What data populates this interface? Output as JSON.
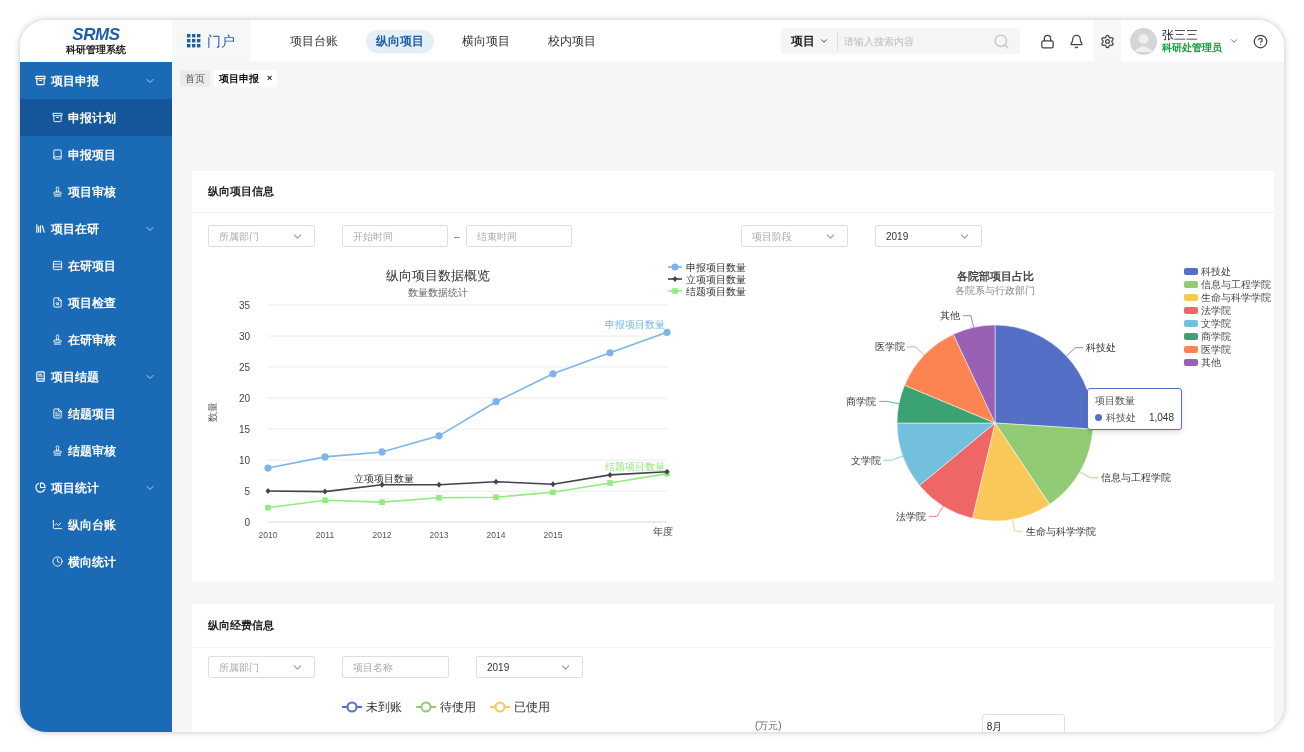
{
  "logo": {
    "mark": "SRMS",
    "subtitle": "科研管理系统"
  },
  "portal": {
    "label": "门户"
  },
  "nav_tabs": [
    {
      "label": "项目台账",
      "selected": false
    },
    {
      "label": "纵向项目",
      "selected": true
    },
    {
      "label": "横向项目",
      "selected": false
    },
    {
      "label": "校内项目",
      "selected": false
    }
  ],
  "search": {
    "scope": "项目",
    "placeholder": "请输入搜索内容"
  },
  "user": {
    "name": "张三三",
    "role": "科研处管理员"
  },
  "sidebar": {
    "groups": [
      {
        "label": "项目申报",
        "expanded": true,
        "children": [
          {
            "label": "申报计划",
            "selected": true
          },
          {
            "label": "申报项目",
            "selected": false
          },
          {
            "label": "项目审核",
            "selected": false
          }
        ]
      },
      {
        "label": "项目在研",
        "expanded": true,
        "children": [
          {
            "label": "在研项目",
            "selected": false
          },
          {
            "label": "项目检查",
            "selected": false
          },
          {
            "label": "在研审核",
            "selected": false
          }
        ]
      },
      {
        "label": "项目结题",
        "expanded": true,
        "children": [
          {
            "label": "结题项目",
            "selected": false
          },
          {
            "label": "结题审核",
            "selected": false
          }
        ]
      },
      {
        "label": "项目统计",
        "expanded": true,
        "children": [
          {
            "label": "纵向台账",
            "selected": false
          },
          {
            "label": "横向统计",
            "selected": false
          }
        ]
      }
    ]
  },
  "page_tabs": [
    {
      "label": "首页",
      "selected": false
    },
    {
      "label": "项目申报",
      "selected": true,
      "close": "×"
    }
  ],
  "project_card": {
    "title": "纵向项目信息",
    "left_filters": [
      {
        "kind": "select",
        "placeholder": "所属部门"
      },
      {
        "kind": "date_range",
        "start_placeholder": "开始时间",
        "separator": "–",
        "end_placeholder": "结束时间"
      }
    ],
    "right_filters": [
      {
        "kind": "select",
        "placeholder": "项目阶段"
      },
      {
        "kind": "select",
        "value": "2019"
      }
    ],
    "line_chart": {
      "subtitle": "数量数据统计",
      "series_labels": [
        "申报项目数量",
        "立项项目数量",
        "结题项目数量"
      ],
      "chart_data": {
        "type": "line",
        "title": "纵向项目数据概览",
        "xlabel": "年度",
        "ylabel": "数量",
        "x": [
          2010,
          2011,
          2012,
          2013,
          2014,
          2015,
          2016,
          2017
        ],
        "xlim": [
          2010,
          2017
        ],
        "grid": true,
        "legend": "upper right",
        "xticks": [
          2010,
          2011,
          2012,
          2013,
          2014,
          2015
        ],
        "ylim": [
          0,
          35
        ],
        "yticks": [
          0,
          5,
          10,
          15,
          20,
          25,
          30,
          35
        ],
        "series": [
          {
            "name": "申报项目数量",
            "color": "#7cb5ec",
            "marker": "circle",
            "values": [
              8.7,
              10.5,
              11.3,
              13.9,
              19.4,
              23.9,
              27.3,
              30.6
            ]
          },
          {
            "name": "立项项目数量",
            "color": "#434348",
            "marker": "diamond",
            "values": [
              5.0,
              4.9,
              6.0,
              6.0,
              6.5,
              6.1,
              7.6,
              8.1
            ]
          },
          {
            "name": "结题项目数量",
            "color": "#90ed7d",
            "marker": "square",
            "values": [
              2.3,
              3.5,
              3.2,
              3.9,
              4.0,
              4.8,
              6.3,
              7.8
            ]
          }
        ]
      }
    },
    "pie_chart": {
      "title": "各院部项目占比",
      "subtitle": "各院系与行政部门",
      "slices": [
        {
          "label": "科技处",
          "color": "#5470c6"
        },
        {
          "label": "信息与工程学院",
          "color": "#91cc75"
        },
        {
          "label": "生命与科学学院",
          "color": "#fac858"
        },
        {
          "label": "法学院",
          "color": "#ee6666"
        },
        {
          "label": "文学院",
          "color": "#73c0de"
        },
        {
          "label": "商学院",
          "color": "#3ba272"
        },
        {
          "label": "医学院",
          "color": "#fc8452"
        },
        {
          "label": "其他",
          "color": "#9a60b4"
        }
      ],
      "legend": [
        {
          "label": "科技处",
          "color": "#5470c6"
        },
        {
          "label": "信息与工程学院",
          "color": "#91cc75"
        },
        {
          "label": "生命与科学学院",
          "color": "#fac858"
        },
        {
          "label": "法学院",
          "color": "#ee6666"
        },
        {
          "label": "文学院",
          "color": "#73c0de"
        },
        {
          "label": "商学院",
          "color": "#3ba272"
        },
        {
          "label": "医学院",
          "color": "#fc8452"
        },
        {
          "label": "其他",
          "color": "#9a60b4"
        }
      ],
      "tooltip": {
        "title": "项目数量",
        "name": "科技处",
        "value": "1,048",
        "color": "#5470c6"
      }
    }
  },
  "funding_card": {
    "title": "纵向经费信息",
    "filters": [
      {
        "kind": "select",
        "placeholder": "所属部门"
      },
      {
        "kind": "input",
        "placeholder": "项目名称"
      },
      {
        "kind": "select",
        "value": "2019"
      }
    ],
    "legend": [
      {
        "label": "未到账",
        "color": "#5470c6"
      },
      {
        "label": "待使用",
        "color": "#91cc75"
      },
      {
        "label": "已使用",
        "color": "#fac858"
      }
    ],
    "unit": "(万元)",
    "month_select": {
      "value": "8月"
    }
  }
}
